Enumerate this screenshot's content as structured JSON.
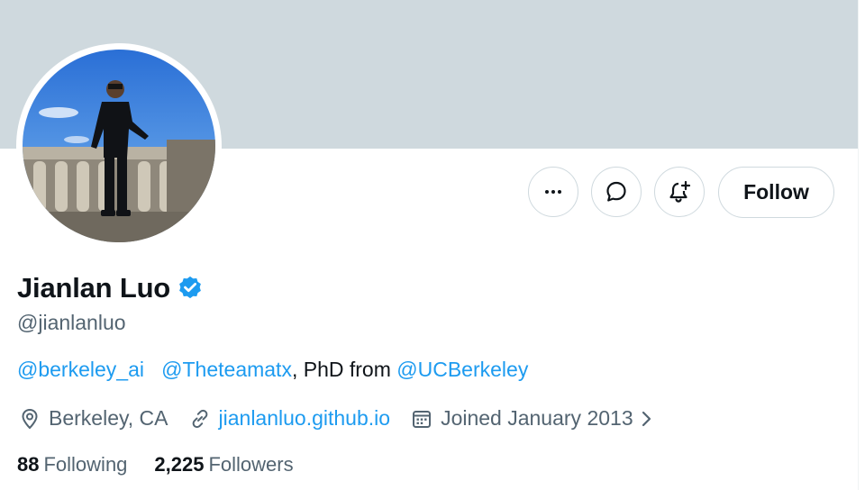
{
  "profile": {
    "display_name": "Jianlan Luo",
    "handle": "@jianlanluo",
    "bio": {
      "mention1": "@berkeley_ai",
      "mention2": "@Theteamatx",
      "text_mid": ", PhD from ",
      "mention3": "@UCBerkeley"
    },
    "location": "Berkeley, CA",
    "website": "jianlanluo.github.io",
    "joined": "Joined January 2013",
    "following_count": "88",
    "following_label": "Following",
    "followers_count": "2,225",
    "followers_label": "Followers"
  },
  "actions": {
    "follow_label": "Follow"
  },
  "icons": {
    "more": "more-horizontal-icon",
    "message": "message-bubble-icon",
    "notify": "bell-plus-icon",
    "verified": "verified-badge-icon",
    "location": "location-pin-icon",
    "link": "link-icon",
    "calendar": "calendar-icon"
  },
  "colors": {
    "accent": "#1d9bf0",
    "banner": "#cfd9de",
    "secondary_text": "#536471",
    "primary_text": "#0f1419"
  }
}
